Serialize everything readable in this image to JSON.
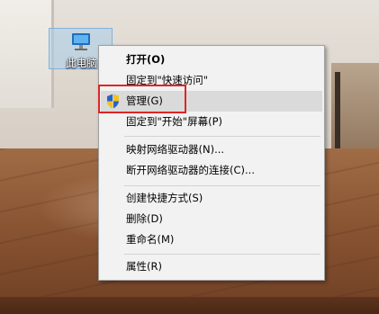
{
  "desktop": {
    "icon_label": "此电脑",
    "icon_name": "computer-icon"
  },
  "context_menu": {
    "items": [
      {
        "label": "打开(O)",
        "bold": true
      },
      {
        "label": "固定到\"快速访问\""
      },
      {
        "label": "管理(G)",
        "icon": "uac-shield-icon",
        "hovered": true,
        "highlighted": true
      },
      {
        "label": "固定到\"开始\"屏幕(P)"
      },
      {
        "label": "映射网络驱动器(N)..."
      },
      {
        "label": "断开网络驱动器的连接(C)..."
      },
      {
        "label": "创建快捷方式(S)"
      },
      {
        "label": "删除(D)"
      },
      {
        "label": "重命名(M)"
      },
      {
        "label": "属性(R)"
      }
    ]
  },
  "colors": {
    "menu_background": "#f2f2f2",
    "hover_background": "#dadada",
    "highlight_border": "#e02424",
    "icon_selection": "#aacdeb"
  }
}
